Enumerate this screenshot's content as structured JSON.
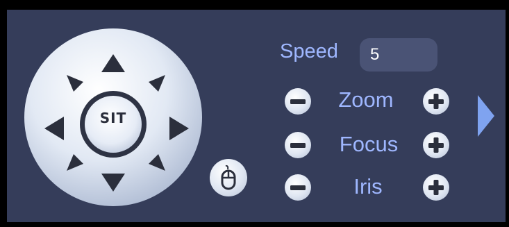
{
  "ptz": {
    "center_label": "SIT",
    "speed_label": "Speed",
    "speed_value": "5",
    "rows": [
      {
        "label": "Zoom"
      },
      {
        "label": "Focus"
      },
      {
        "label": "Iris"
      }
    ]
  },
  "icons": {
    "up": "arrow-up-icon",
    "down": "arrow-down-icon",
    "left": "arrow-left-icon",
    "right": "arrow-right-icon",
    "up_left": "arrow-up-left-icon",
    "up_right": "arrow-up-right-icon",
    "down_left": "arrow-down-left-icon",
    "down_right": "arrow-down-right-icon",
    "minus": "minus-icon",
    "plus": "plus-icon",
    "mouse": "mouse-icon",
    "next": "chevron-right-icon"
  },
  "colors": {
    "panel_bg": "#353d5a",
    "label_text": "#9fb7ff",
    "speed_field_bg": "#4a5375",
    "button_face": "#dfe6f2",
    "arrow_dark": "#2b2f3c",
    "next_arrow": "#7fa3f0"
  }
}
